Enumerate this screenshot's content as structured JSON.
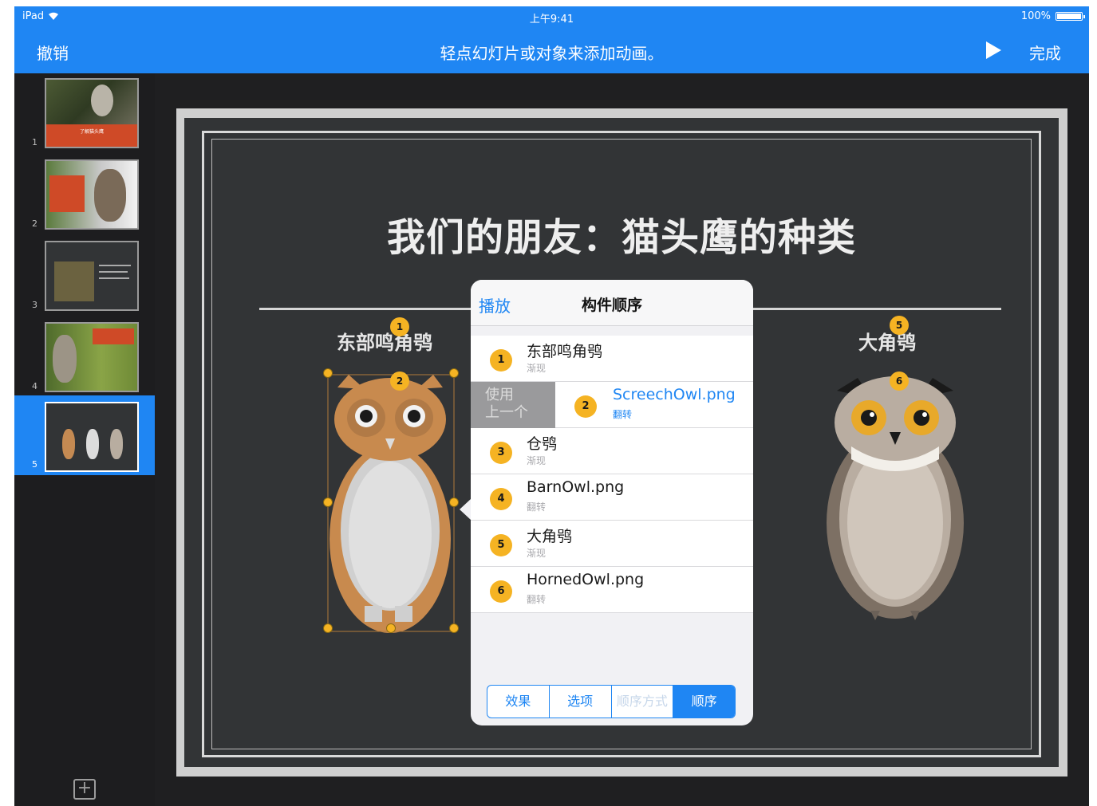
{
  "status_bar": {
    "device": "iPad",
    "time": "上午9:41",
    "battery": "100%"
  },
  "nav": {
    "undo_label": "撤销",
    "hint": "轻点幻灯片或对象来添加动画。",
    "play_icon": "play-icon",
    "done_label": "完成"
  },
  "slides": [
    {
      "number": "1",
      "title_text": "了解猫头鹰"
    },
    {
      "number": "2"
    },
    {
      "number": "3"
    },
    {
      "number": "4"
    },
    {
      "number": "5",
      "selected": true
    }
  ],
  "slide": {
    "title": "我们的朋友：猫头鹰的种类",
    "left_owl_label": "东部鸣角鸮",
    "right_owl_label": "大角鸮",
    "badges": {
      "b1": "1",
      "b2": "2",
      "b5": "5",
      "b6": "6"
    }
  },
  "popover": {
    "play_label": "播放",
    "title": "构件顺序",
    "swipe_action": "使用\n上一个",
    "rows": [
      {
        "num": "1",
        "name": "东部鸣角鸮",
        "sub": "渐现"
      },
      {
        "num": "2",
        "name": "ScreechOwl.png",
        "sub": "翻转"
      },
      {
        "num": "3",
        "name": "仓鸮",
        "sub": "渐现"
      },
      {
        "num": "4",
        "name": "BarnOwl.png",
        "sub": "翻转"
      },
      {
        "num": "5",
        "name": "大角鸮",
        "sub": "渐现"
      },
      {
        "num": "6",
        "name": "HornedOwl.png",
        "sub": "翻转"
      }
    ],
    "segments": [
      {
        "label": "效果"
      },
      {
        "label": "选项"
      },
      {
        "label": "顺序方式",
        "disabled": true
      },
      {
        "label": "顺序",
        "active": true
      }
    ]
  },
  "colors": {
    "accent": "#1f86f3",
    "badge": "#f5b323",
    "slide_bg": "#323436"
  }
}
